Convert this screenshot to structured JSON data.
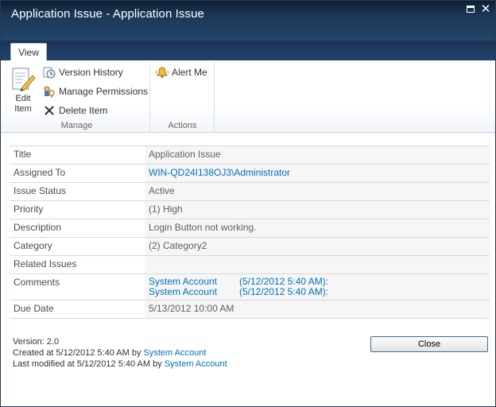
{
  "window": {
    "title": "Application Issue - Application Issue",
    "maximize_icon": "maximize-icon",
    "close_icon": "close-icon"
  },
  "ribbon": {
    "tab": "View",
    "manage": {
      "group_label": "Manage",
      "edit_item_line1": "Edit",
      "edit_item_line2": "Item",
      "version_history": "Version History",
      "manage_permissions": "Manage Permissions",
      "delete_item": "Delete Item"
    },
    "actions": {
      "group_label": "Actions",
      "alert_me": "Alert Me"
    }
  },
  "fields": {
    "title": {
      "label": "Title",
      "value": "Application Issue"
    },
    "assigned_to": {
      "label": "Assigned To",
      "value": "WIN-QD24I138OJ3\\Administrator"
    },
    "issue_status": {
      "label": "Issue Status",
      "value": "Active"
    },
    "priority": {
      "label": "Priority",
      "value": "(1) High"
    },
    "description": {
      "label": "Description",
      "value": "Login Button not working."
    },
    "category": {
      "label": "Category",
      "value": "(2) Category2"
    },
    "related_issues": {
      "label": "Related Issues",
      "value": ""
    },
    "comments": {
      "label": "Comments",
      "entries": [
        {
          "author": "System Account",
          "date": "(5/12/2012 5:40 AM)",
          "suffix": ":"
        },
        {
          "author": "System Account",
          "date": "(5/12/2012 5:40 AM)",
          "suffix": ":"
        }
      ]
    },
    "due_date": {
      "label": "Due Date",
      "value": "5/13/2012 10:00 AM"
    }
  },
  "footer": {
    "version": "Version: 2.0",
    "created_prefix": "Created at 5/12/2012 5:40 AM by",
    "created_by": "System Account",
    "modified_prefix": "Last modified at 5/12/2012 5:40 AM by",
    "modified_by": "System Account",
    "close_button": "Close"
  },
  "colors": {
    "titlebar": "#1d3656",
    "link": "#0072bc",
    "value_bg": "#f6f6f6"
  }
}
